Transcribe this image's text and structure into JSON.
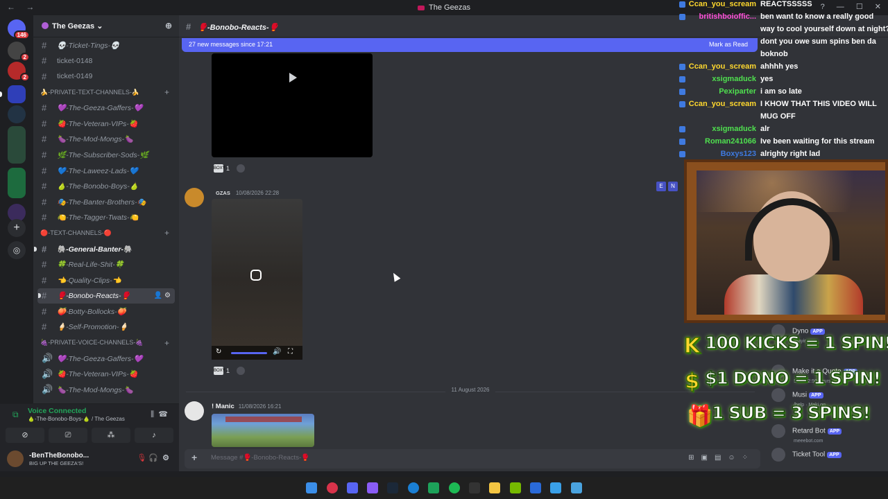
{
  "window": {
    "title": "The Geezas",
    "back": "←",
    "forward": "→",
    "controls": [
      "?",
      "—",
      "☐",
      "✕"
    ]
  },
  "servers": {
    "home_badge": "146",
    "items_badges": [
      "2",
      "2",
      "",
      "",
      "",
      "",
      "",
      ""
    ]
  },
  "guild": {
    "name": "The Geezas ⌄",
    "invite_icon": "person-add-icon"
  },
  "channel_list": [
    {
      "type": "channel",
      "label": "💀-Ticket-Tings-💀",
      "style": "italic"
    },
    {
      "type": "channel",
      "label": "ticket-0148",
      "style": "plain"
    },
    {
      "type": "channel",
      "label": "ticket-0149",
      "style": "plain"
    },
    {
      "type": "category",
      "label": "🍌-PRIVATE-TEXT-CHANNELS-🍌"
    },
    {
      "type": "channel",
      "label": "💜-The-Geeza-Gaffers-💜",
      "style": "italic"
    },
    {
      "type": "channel",
      "label": "🍓-The-Veteran-VIPs-🍓",
      "style": "italic"
    },
    {
      "type": "channel",
      "label": "🍆-The-Mod-Mongs-🍆",
      "style": "italic"
    },
    {
      "type": "channel",
      "label": "🌿-The-Subscriber-Sods-🌿",
      "style": "italic"
    },
    {
      "type": "channel",
      "label": "💙-The-Laweez-Lads-💙",
      "style": "italic"
    },
    {
      "type": "channel",
      "label": "🍐-The-Bonobo-Boys-🍐",
      "style": "italic"
    },
    {
      "type": "channel",
      "label": "🎭-The-Banter-Brothers-🎭",
      "style": "italic"
    },
    {
      "type": "channel",
      "label": "🍋-The-Tagger-Twats-🍋",
      "style": "italic"
    },
    {
      "type": "category",
      "label": "🔴-TEXT-CHANNELS-🔴"
    },
    {
      "type": "channel",
      "label": "🐘-General-Banter-🐘",
      "style": "bold"
    },
    {
      "type": "channel",
      "label": "🍀-Real-Life-Shit-🍀",
      "style": "italic"
    },
    {
      "type": "channel",
      "label": "👈-Quality-Clips-👈",
      "style": "italic"
    },
    {
      "type": "channel",
      "label": "🥊-Bonobo-Reacts-🥊",
      "style": "active"
    },
    {
      "type": "channel",
      "label": "🍑-Botty-Bollocks-🍑",
      "style": "italic"
    },
    {
      "type": "channel",
      "label": "🍦-Self-Promotion-🍦",
      "style": "italic"
    },
    {
      "type": "category",
      "label": "🍇-PRIVATE-VOICE-CHANNELS-🍇"
    },
    {
      "type": "voice",
      "label": "💜-The-Geeza-Gaffers-💜",
      "style": "italic"
    },
    {
      "type": "voice",
      "label": "🍓-The-Veteran-VIPs-🍓",
      "style": "italic"
    },
    {
      "type": "voice",
      "label": "🍆-The-Mod-Mongs-🍆",
      "style": "italic"
    }
  ],
  "voice": {
    "status": "Voice Connected",
    "channel": "🍐-The-Bonobo-Boys-🍐 / The Geezas"
  },
  "user": {
    "name": "-BenTheBonobo...",
    "status": "BIG UP THE GEEZA'S!"
  },
  "chat": {
    "channel_name": "🥊-Bonobo-Reacts-🥊",
    "new_messages": "27 new messages since 17:21",
    "mark_read": "Mark as Read",
    "reaction_count_1": "1",
    "reaction_count_2": "1",
    "msg2": {
      "author": "",
      "tag": "GZAS",
      "time": "10/08/2026 22:28"
    },
    "msg2_side": [
      "E",
      "N"
    ],
    "divider": "11 August 2026",
    "msg3": {
      "author": "! Manic",
      "time": "11/08/2026 16:21"
    },
    "composer_placeholder": "Message #🥊-Bonobo-Reacts-🥊"
  },
  "stream_chat": [
    {
      "user": "Ccan_you_scream",
      "text": "REACTSSSSS",
      "color": "#ffd82e"
    },
    {
      "user": "britishboioffic...",
      "text": "ben want to know a really good",
      "color": "#ff4fd8"
    },
    {
      "user": "",
      "text": "way to cool yourself down at night?",
      "color": "#ffffff"
    },
    {
      "user": "",
      "text": "dont you owe sum spins ben da",
      "color": "#ffffff"
    },
    {
      "user": "",
      "text": "boknob",
      "color": "#ffffff"
    },
    {
      "user": "Ccan_you_scream",
      "text": "ahhhh yes",
      "color": "#ffd82e"
    },
    {
      "user": "xsigmaduck",
      "text": "yes",
      "color": "#4fe04f"
    },
    {
      "user": "Pexiparter",
      "text": "i am so late",
      "color": "#4fe04f"
    },
    {
      "user": "Ccan_you_scream",
      "text": "I KHOW THAT THIS VIDEO WILL",
      "color": "#ffd82e"
    },
    {
      "user": "",
      "text": "MUG OFF",
      "color": "#ffffff"
    },
    {
      "user": "xsigmaduck",
      "text": "alr",
      "color": "#4fe04f"
    },
    {
      "user": "Roman241066",
      "text": "Ive been waiting for this stream",
      "color": "#4fe04f"
    },
    {
      "user": "Boxys123",
      "text": "alrighty right lad",
      "color": "#3f7ae0"
    }
  ],
  "members": [
    {
      "name": "Dyno",
      "sub": "Playing..."
    },
    {
      "name": "Make it a Quote",
      "sub": "Sent 22:50 hours"
    },
    {
      "name": "Musi",
      "sub": "/help · Maki.gg"
    },
    {
      "name": "Retard Bot",
      "sub": "meeebot.com"
    },
    {
      "name": "Ticket Tool",
      "sub": ""
    }
  ],
  "member_app_label": "APP",
  "promos": [
    {
      "icon": "K",
      "text": "100 KICKS = 1 SPIN!"
    },
    {
      "icon": "$",
      "text": "$1 DONO = 1 SPIN!"
    },
    {
      "icon": "🎁",
      "text": "1 SUB = 3 SPINS!"
    }
  ]
}
